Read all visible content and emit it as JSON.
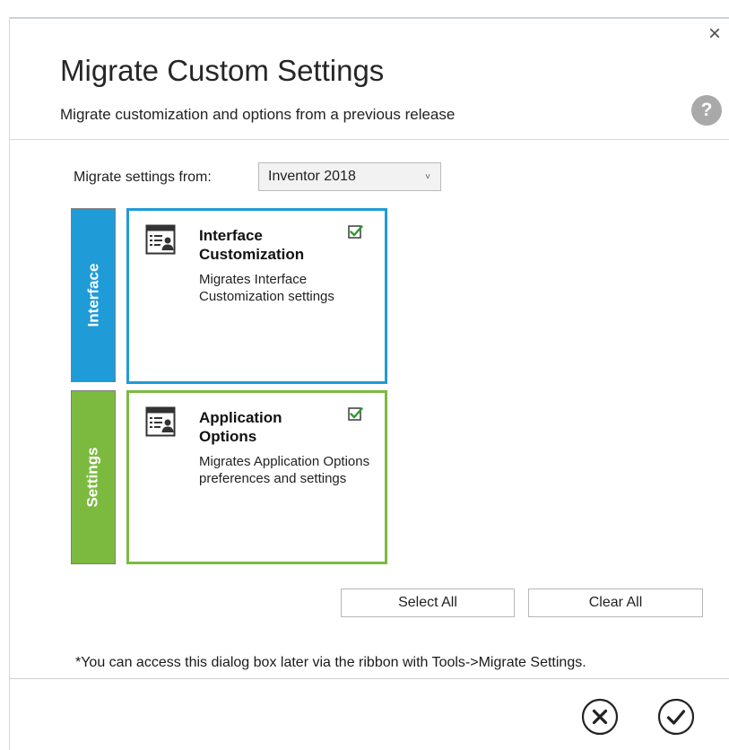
{
  "dialog": {
    "title": "Migrate Custom Settings",
    "subtitle": "Migrate customization and options from a previous release",
    "close_symbol": "×",
    "help_symbol": "?"
  },
  "source": {
    "label": "Migrate settings from:",
    "selected": "Inventor 2018",
    "chevron": "˅"
  },
  "categories": [
    {
      "tab_label": "Interface",
      "tab_color": "#1f9bd8",
      "title": "Interface Customization",
      "description": "Migrates Interface Customization settings",
      "checked": true,
      "icon": "settings-panel-user-icon"
    },
    {
      "tab_label": "Settings",
      "tab_color": "#7cba3f",
      "title": "Application Options",
      "description": "Migrates Application Options preferences and settings",
      "checked": true,
      "icon": "settings-panel-user-icon"
    }
  ],
  "actions": {
    "select_all": "Select All",
    "clear_all": "Clear All"
  },
  "footnote": "*You can access this dialog box later via the ribbon with Tools->Migrate Settings.",
  "footer": {
    "cancel_icon": "circle-x-icon",
    "ok_icon": "circle-check-icon"
  }
}
